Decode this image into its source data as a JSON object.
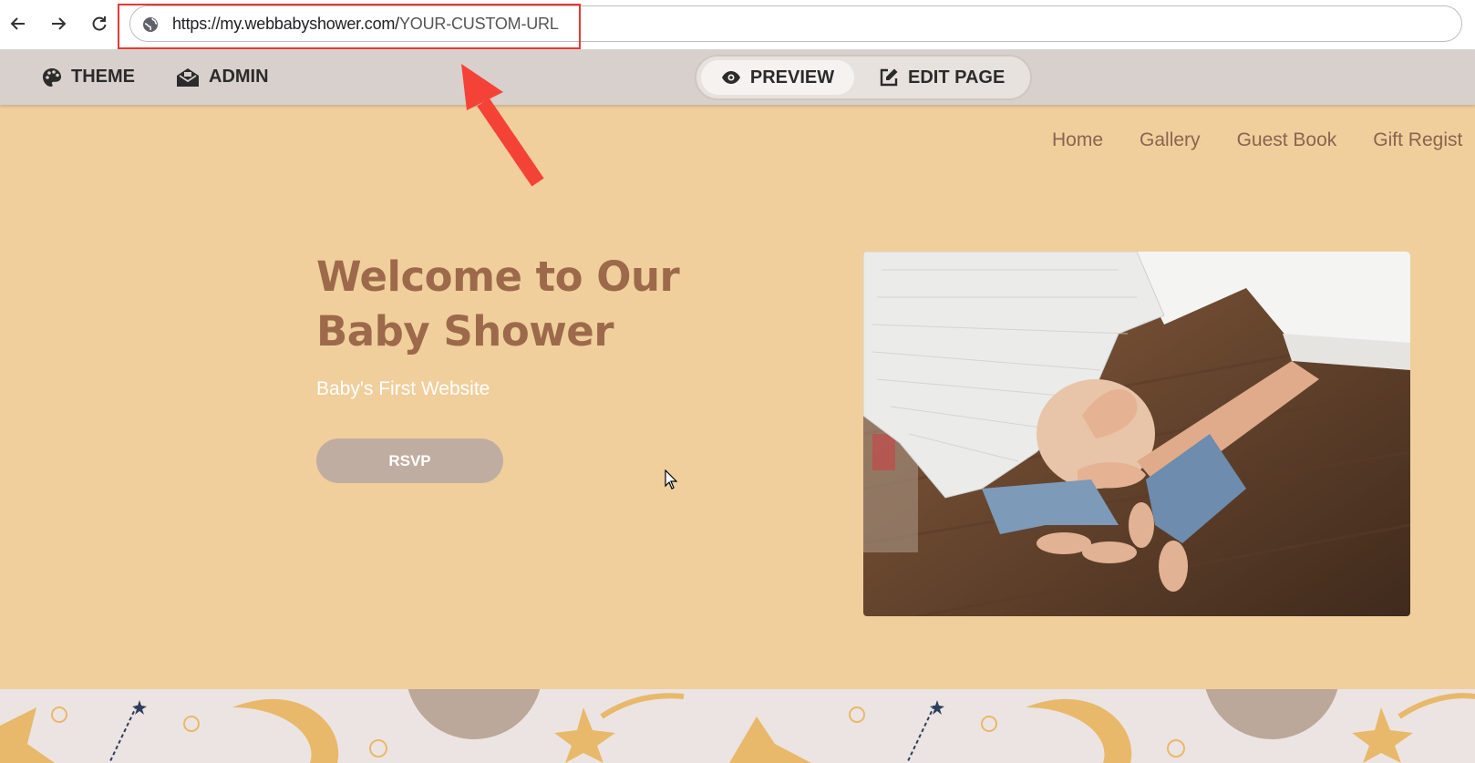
{
  "browser": {
    "url_host": "https://my.webbabyshower.com/",
    "url_path": "YOUR-CUSTOM-URL",
    "back_icon": "arrow-left-icon",
    "forward_icon": "arrow-right-icon",
    "reload_icon": "reload-icon",
    "site_icon": "globe-icon"
  },
  "admin_bar": {
    "theme_label": "THEME",
    "admin_label": "ADMIN",
    "preview_label": "PREVIEW",
    "edit_label": "EDIT PAGE"
  },
  "nav": {
    "items": [
      "Home",
      "Gallery",
      "Guest Book",
      "Gift Regist"
    ]
  },
  "hero": {
    "title_line1": "Welcome to Our",
    "title_line2": "Baby Shower",
    "subtitle": "Baby's First Website",
    "rsvp_label": "RSVP"
  },
  "colors": {
    "page_bg": "#f0cf9c",
    "admin_bar_bg": "#d8d0cc",
    "title": "#9c6a4a",
    "nav_text": "#8a6450",
    "rsvp_bg": "#c0ada1",
    "annotation": "#e53935"
  }
}
